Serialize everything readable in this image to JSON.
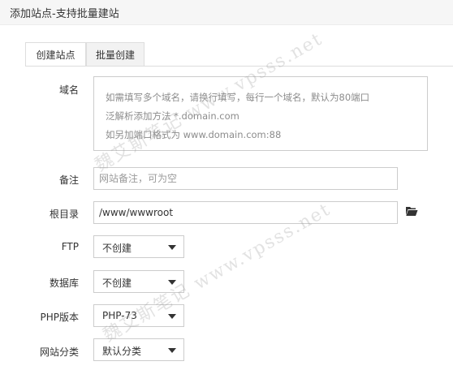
{
  "header": {
    "title": "添加站点-支持批量建站"
  },
  "tabs": [
    {
      "label": "创建站点",
      "active": true
    },
    {
      "label": "批量创建",
      "active": false
    }
  ],
  "form": {
    "domain": {
      "label": "域名",
      "placeholder_lines": [
        "如需填写多个域名，请换行填写，每行一个域名，默认为80端口",
        "泛解析添加方法 *.domain.com",
        "如另加端口格式为 www.domain.com:88"
      ]
    },
    "remark": {
      "label": "备注",
      "placeholder": "网站备注，可为空"
    },
    "root": {
      "label": "根目录",
      "value": "/www/wwwroot",
      "icon": "folder-open-icon"
    },
    "ftp": {
      "label": "FTP",
      "selected": "不创建"
    },
    "database": {
      "label": "数据库",
      "selected": "不创建"
    },
    "php": {
      "label": "PHP版本",
      "selected": "PHP-73"
    },
    "category": {
      "label": "网站分类",
      "selected": "默认分类"
    }
  },
  "watermarks": [
    "魏艾斯笔记 www.vpsss.net",
    "魏艾斯笔记 www.vpsss.net"
  ]
}
